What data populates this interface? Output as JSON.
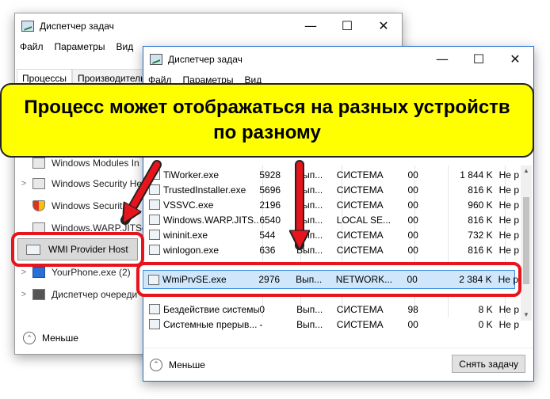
{
  "back_window": {
    "title": "Диспетчер задач",
    "controls": [
      "—",
      "☐",
      "✕"
    ],
    "menu": [
      "Файл",
      "Параметры",
      "Вид"
    ],
    "tabs": [
      "Процессы",
      "Производитель"
    ],
    "processes": [
      {
        "chev": "",
        "name": "Windows Modules In",
        "icon": "window-icon"
      },
      {
        "chev": ">",
        "name": "Windows Security He",
        "icon": "window-icon"
      },
      {
        "chev": "",
        "name": "Windows Securit",
        "icon": "shield-icon"
      },
      {
        "chev": "",
        "name": "Windows.WARP.JITSe",
        "icon": "window-icon"
      },
      {
        "chev": ">",
        "name": "YourPhone.exe (2)",
        "icon": "phone-icon"
      },
      {
        "chev": ">",
        "name": "Диспетчер очереди",
        "icon": "printer-icon"
      }
    ],
    "highlighted_process": "WMI Provider Host",
    "footer_label": "Меньше"
  },
  "front_window": {
    "title": "Диспетчер задач",
    "controls": [
      "—",
      "☐",
      "✕"
    ],
    "menu": [
      "Файл",
      "Параметры",
      "Вид"
    ],
    "rows": [
      [
        "TiWorker.exe",
        "5928",
        "Вып...",
        "СИСТЕМА",
        "00",
        "1 844 K",
        "Не р"
      ],
      [
        "TrustedInstaller.exe",
        "5696",
        "Вып...",
        "СИСТЕМА",
        "00",
        "816 K",
        "Не р"
      ],
      [
        "VSSVC.exe",
        "2196",
        "Вып...",
        "СИСТЕМА",
        "00",
        "960 K",
        "Не р"
      ],
      [
        "Windows.WARP.JITS...",
        "6540",
        "Вып...",
        "LOCAL SE...",
        "00",
        "816 K",
        "Не р"
      ],
      [
        "wininit.exe",
        "544",
        "Вып...",
        "СИСТЕМА",
        "00",
        "732 K",
        "Не р"
      ],
      [
        "winlogon.exe",
        "636",
        "Вып...",
        "СИСТЕМА",
        "00",
        "816 K",
        "Не р"
      ]
    ],
    "highlighted_row": [
      "WmiPrvSE.exe",
      "2976",
      "Вып...",
      "NETWORK...",
      "00",
      "2 384 K",
      "Не р"
    ],
    "bottom_rows": [
      [
        "Бездействие системы",
        "0",
        "Вып...",
        "СИСТЕМА",
        "98",
        "8 K",
        "Не р"
      ],
      [
        "Системные прерыв...",
        "-",
        "Вып...",
        "СИСТЕМА",
        "00",
        "0 K",
        "Не р"
      ]
    ],
    "footer_label": "Меньше",
    "end_task_label": "Снять задачу"
  },
  "banner": {
    "line1": "Процесс может отображаться на разных устройств",
    "line2": "по разному",
    "color": "#ffff00"
  },
  "annotation_color": "#e8141b"
}
